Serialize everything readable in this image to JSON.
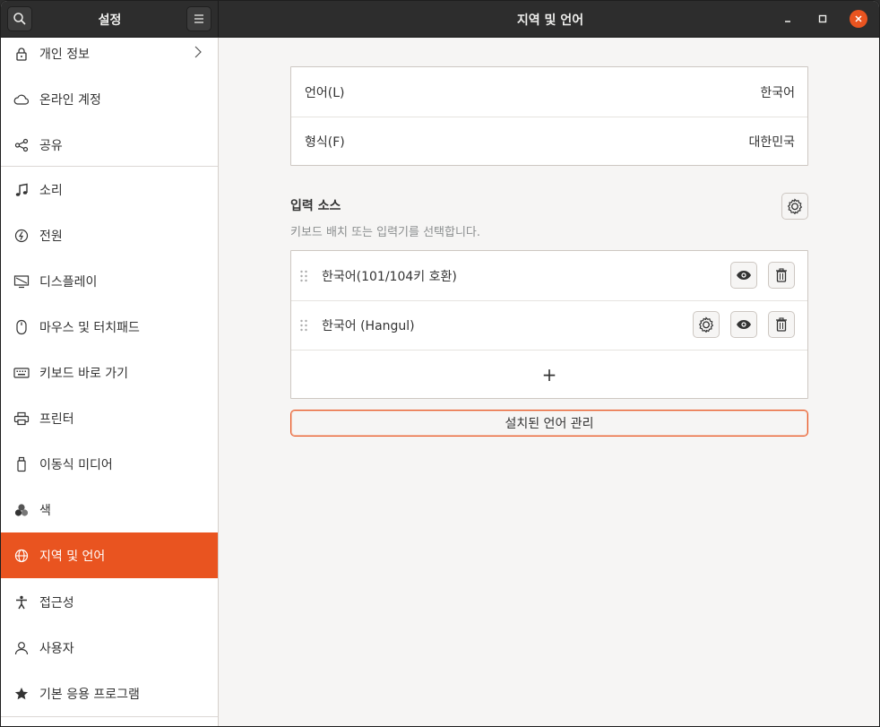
{
  "window": {
    "sidebar_title": "설정",
    "main_title": "지역 및 언어"
  },
  "sidebar": {
    "items": [
      {
        "label": "개인 정보",
        "icon": "lock-icon"
      },
      {
        "label": "온라인 계정",
        "icon": "cloud-icon"
      },
      {
        "label": "공유",
        "icon": "share-icon"
      },
      {
        "label": "소리",
        "icon": "music-note-icon"
      },
      {
        "label": "전원",
        "icon": "power-icon"
      },
      {
        "label": "디스플레이",
        "icon": "display-icon"
      },
      {
        "label": "마우스 및 터치패드",
        "icon": "mouse-icon"
      },
      {
        "label": "키보드 바로 가기",
        "icon": "keyboard-icon"
      },
      {
        "label": "프린터",
        "icon": "printer-icon"
      },
      {
        "label": "이동식 미디어",
        "icon": "removable-media-icon"
      },
      {
        "label": "색",
        "icon": "color-icon"
      },
      {
        "label": "지역 및 언어",
        "icon": "globe-icon"
      },
      {
        "label": "접근성",
        "icon": "accessibility-icon"
      },
      {
        "label": "사용자",
        "icon": "user-icon"
      },
      {
        "label": "기본 응용 프로그램",
        "icon": "star-icon"
      }
    ],
    "active_index": 11
  },
  "language": {
    "language_label": "언어(L)",
    "language_value": "한국어",
    "formats_label": "형식(F)",
    "formats_value": "대한민국"
  },
  "input_sources": {
    "title": "입력 소스",
    "subtitle": "키보드 배치 또는 입력기를 선택합니다.",
    "sources": [
      {
        "label": "한국어(101/104키 호환)",
        "has_settings": false
      },
      {
        "label": "한국어 (Hangul)",
        "has_settings": true
      }
    ],
    "add_label": "+"
  },
  "manage_button_label": "설치된 언어 관리",
  "colors": {
    "accent": "#e95420",
    "headerbar": "#2d2d2d",
    "sidebar_bg": "#ffffff",
    "main_bg": "#f6f5f4"
  }
}
